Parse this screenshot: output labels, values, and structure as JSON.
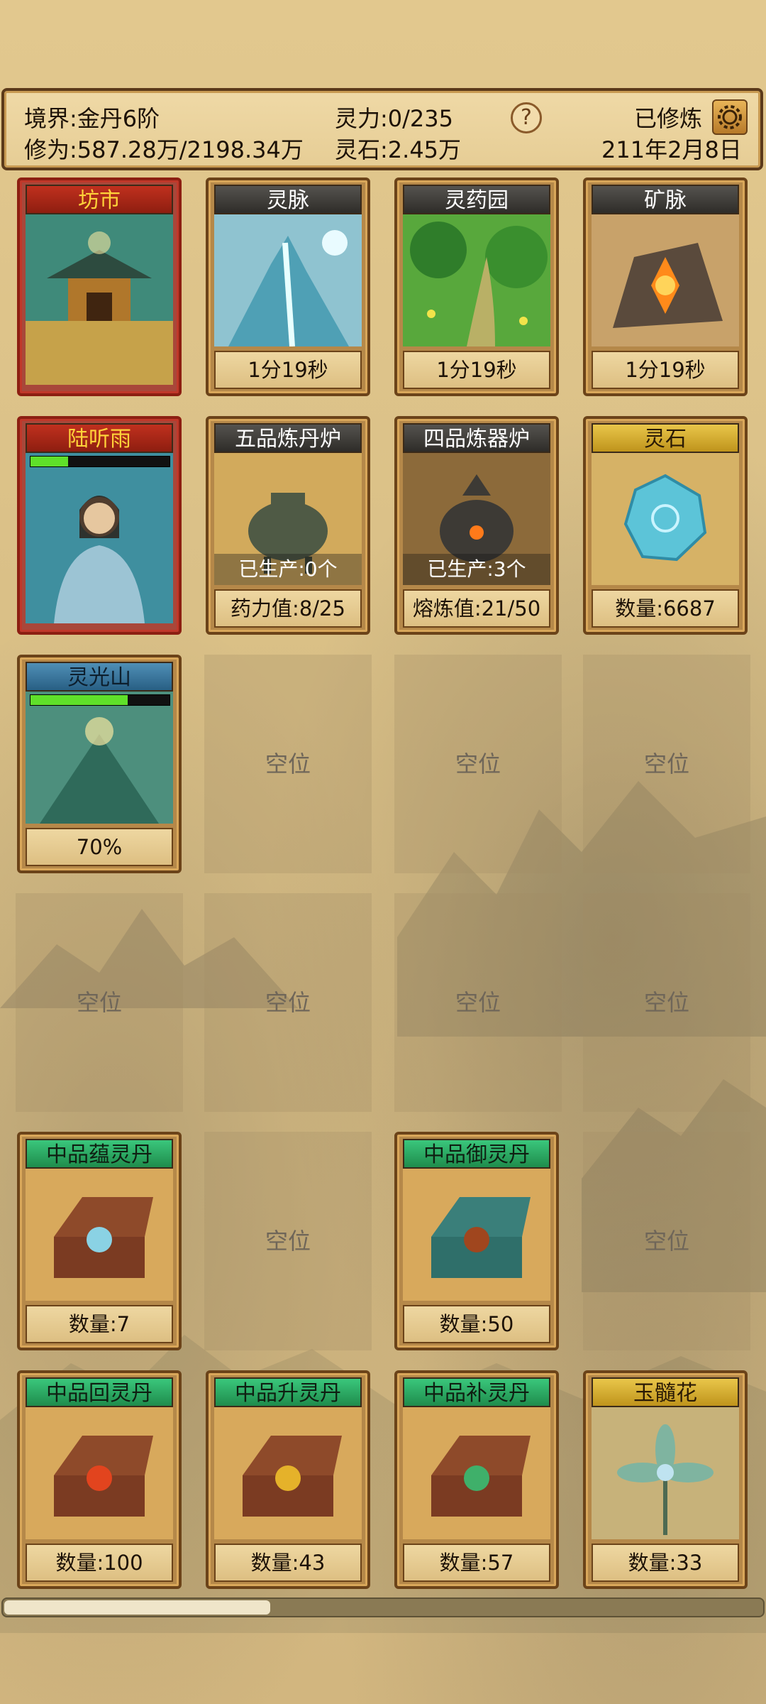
{
  "header": {
    "realm": "境界:金丹6阶",
    "cultivation": "修为:587.28万/2198.34万",
    "spirit_power": "灵力:0/235",
    "spirit_stone": "灵石:2.45万",
    "help": "?",
    "status": "已修炼",
    "date": "211年2月8日"
  },
  "cards": {
    "c1": {
      "title": "坊市"
    },
    "c2": {
      "title": "灵脉",
      "footer": "1分19秒"
    },
    "c3": {
      "title": "灵药园",
      "footer": "1分19秒"
    },
    "c4": {
      "title": "矿脉",
      "footer": "1分19秒"
    },
    "c5": {
      "title": "陆听雨",
      "hp_fraction": 0.27
    },
    "c6": {
      "title": "五品炼丹炉",
      "overlay": "已生产:0个",
      "footer": "药力值:8/25"
    },
    "c7": {
      "title": "四品炼器炉",
      "overlay": "已生产:3个",
      "footer": "熔炼值:21/50"
    },
    "c8": {
      "title": "灵石",
      "footer": "数量:6687"
    },
    "c9": {
      "title": "灵光山",
      "footer": "70%",
      "progress": 0.7
    },
    "c10": {
      "title": "中品蕴灵丹",
      "footer": "数量:7"
    },
    "c11": {
      "title": "中品御灵丹",
      "footer": "数量:50"
    },
    "c12": {
      "title": "中品回灵丹",
      "footer": "数量:100"
    },
    "c13": {
      "title": "中品升灵丹",
      "footer": "数量:43"
    },
    "c14": {
      "title": "中品补灵丹",
      "footer": "数量:57"
    },
    "c15": {
      "title": "玉髓花",
      "footer": "数量:33"
    }
  },
  "empty_label": "空位",
  "scroll": {
    "fraction": 0.35
  },
  "colors": {
    "title_red": "#c0301e",
    "title_dark": "#3e3c39",
    "title_green": "#2aa863",
    "title_gold": "#d9b033",
    "title_blue": "#3d7aa1",
    "hp_green": "#5fe02a"
  }
}
